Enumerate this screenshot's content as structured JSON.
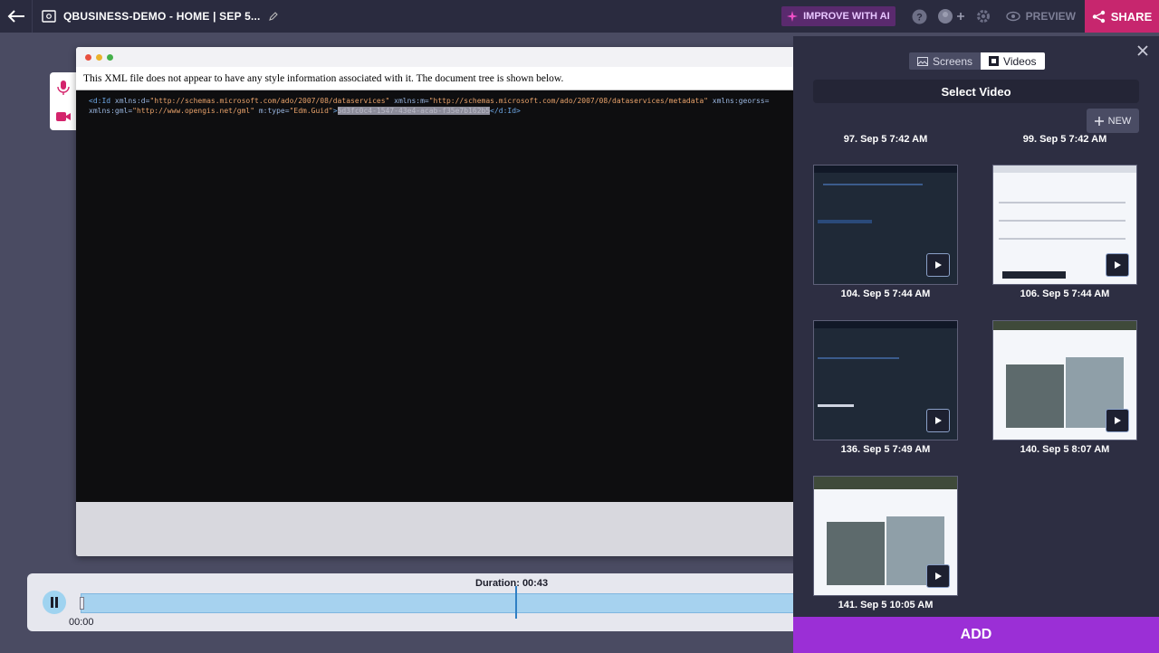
{
  "topbar": {
    "title": "QBUSINESS-DEMO - HOME | SEP 5...",
    "improve_label": "IMPROVE WITH AI",
    "preview_label": "PREVIEW",
    "share_label": "SHARE"
  },
  "browser": {
    "xml_notice": "This XML file does not appear to have any style information associated with it. The document tree is shown below.",
    "xml_line1": {
      "open": "<d:Id",
      "attr1": " xmlns:d=",
      "val1": "\"http://schemas.microsoft.com/ado/2007/08/dataservices\"",
      "attr2": " xmlns:m=",
      "val2": "\"http://schemas.microsoft.com/ado/2007/08/dataservices/metadata\"",
      "attr3": " xmlns:georss="
    },
    "xml_line2": {
      "attr1": "xmlns:gml=",
      "val1": "\"http://www.opengis.net/gml\"",
      "attr2": " m:type=",
      "val2": "\"Edm.Guid\"",
      "close_start": ">",
      "selected": "5d3fc0c4-1547-43e4-acab-f35e7b162b5",
      "close": "</d:Id>"
    }
  },
  "panel": {
    "tab_screens": "Screens",
    "tab_videos": "Videos",
    "select_video": "Select Video",
    "new_label": "NEW",
    "captions": [
      "97. Sep 5 7:42 AM",
      "99. Sep 5 7:42 AM",
      "104. Sep 5 7:44 AM",
      "106. Sep 5 7:44 AM",
      "136. Sep 5 7:49 AM",
      "140. Sep 5 8:07 AM",
      "141. Sep 5 10:05 AM"
    ],
    "add_label": "ADD"
  },
  "timeline": {
    "duration": "Duration: 00:43",
    "start_time": "00:00"
  }
}
